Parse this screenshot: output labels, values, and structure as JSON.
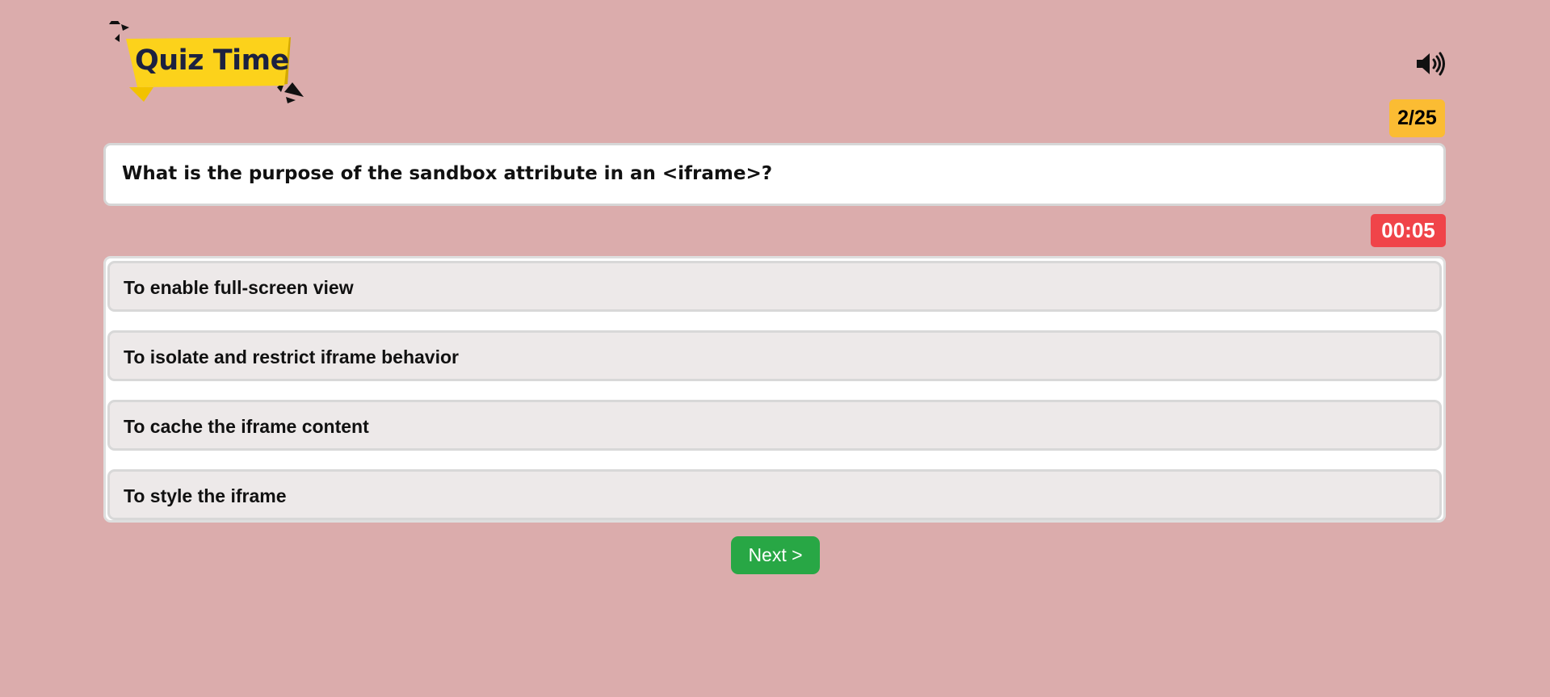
{
  "header": {
    "logo_text": "Quiz Time",
    "sound_icon": "speaker-volume-icon"
  },
  "progress": {
    "counter": "2/25"
  },
  "question": {
    "text": "What is the purpose of the sandbox attribute in an <iframe>?"
  },
  "timer": {
    "value": "00:05"
  },
  "options": [
    {
      "label": "To enable full-screen view"
    },
    {
      "label": "To isolate and restrict iframe behavior"
    },
    {
      "label": "To cache the iframe content"
    },
    {
      "label": "To style the iframe"
    }
  ],
  "actions": {
    "next_label": "Next >"
  },
  "colors": {
    "background": "#dbacac",
    "logo_banner": "#fcd21b",
    "counter_badge": "#fbbc33",
    "timer_badge": "#f04449",
    "next_button": "#28a745"
  }
}
